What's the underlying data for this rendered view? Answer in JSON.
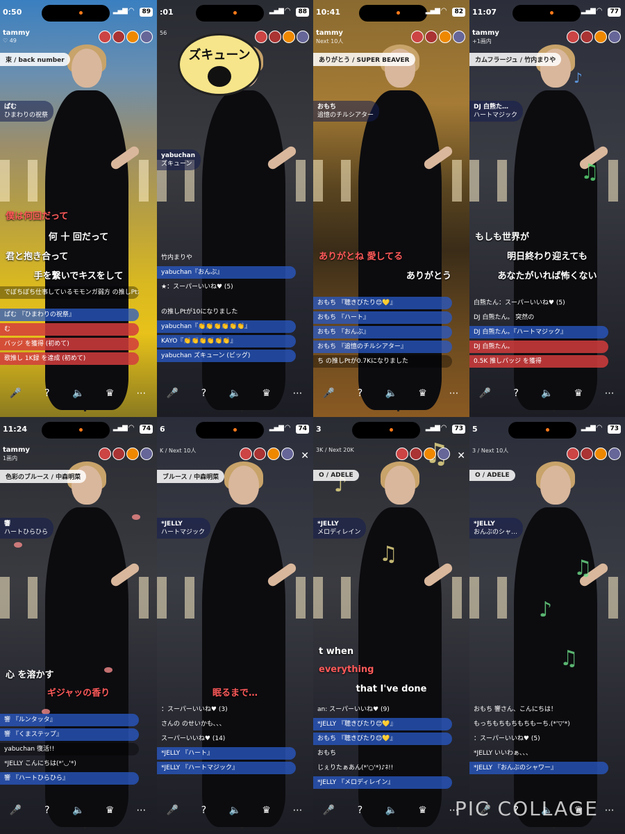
{
  "panels": [
    {
      "time": "0:50",
      "battery": "89",
      "host": "tammy",
      "host_sub": "♡ 49",
      "song": "束 / back number",
      "singer_name": "ぱむ",
      "singer_song": "ひまわりの祝祭",
      "lyrics": [
        "僕は何回だって",
        "何 十 回だって",
        "君と抱き合って",
        "手を繋いでキスをして"
      ],
      "feed": [
        "でぼちぼち仕事しているモモンガ弱方 の推しPtがになりました",
        "ぱむ 『ひまわりの祝祭』",
        "む",
        "バッジ を獲得 (初めて)",
        "歌推し 1K録 を達成 (初めて)"
      ]
    },
    {
      "time": ":01",
      "battery": "88",
      "host": "",
      "host_sub": "56",
      "sticker": "ズキューン",
      "singer_name": "yabuchan",
      "singer_song": "ズキューン",
      "feed": [
        "竹内まりや",
        "yabuchan『おんぶ』",
        "★：スーパーいいね♥ (5)",
        "の推しPtが10になりました",
        "yabuchan『👏👏👏👏👏👏』",
        "KAYO『👏👏👏👏👏👏』",
        "yabuchan ズキューン (ビッグ)"
      ]
    },
    {
      "time": "10:41",
      "battery": "82",
      "host": "tammy",
      "host_sub": "Next 10人",
      "song": "ありがとう / SUPER BEAVER",
      "singer_name": "おもち",
      "singer_song": "追憶のチルシアター",
      "lyrics": [
        "ありがとね 愛してる",
        "ありがとう"
      ],
      "feed": [
        "おもち 『聴きびたり😊💛』",
        "おもち 『ハート』",
        "おもち 『おんぶ』",
        "おもち 『追憶のチルシアター』",
        "ち の推しPtが0.7Kになりました"
      ]
    },
    {
      "time": "11:07",
      "battery": "77",
      "host": "tammy",
      "host_sub": "+1画内",
      "song": "カムフラージュ / 竹内まりや",
      "singer_name": "DJ 白熊た…",
      "singer_song": "ハートマジック",
      "lyrics": [
        "もしも世界が",
        "明日終わり迎えても",
        "あなたがいれば怖くない"
      ],
      "feed": [
        "白熊たん：スーパーいいね♥ (5)",
        "DJ 白熊たん。 突然の",
        "DJ 白熊たん。『ハートマジック』",
        "DJ 白熊たん。",
        "0.5K 推しバッジ を獲得"
      ]
    },
    {
      "time": "11:24",
      "battery": "74",
      "host": "tammy",
      "host_sub": "1画内",
      "song": "色彩のブルース / 中森明菜",
      "singer_name": "響",
      "singer_song": "ハートひらひら",
      "lyrics": [
        "心 を溶かす",
        "ギジャッの香り"
      ],
      "feed": [
        "響 『ルンタッタ』",
        "響 『くまステップ』",
        "yabuchan 復活!!",
        "*JELLY こんにちは(*'◡'*)",
        "響 『ハートひらひら』"
      ]
    },
    {
      "time": "6",
      "battery": "74",
      "host": "",
      "host_sub": "K / Next 10人",
      "song": "ブルース / 中森明菜",
      "singer_name": "*JELLY",
      "singer_song": "ハートマジック",
      "lyrics": [
        "眠るまで…"
      ],
      "feed": [
        "：スーパーいいね♥ (3)",
        "さんの のせいかも、、、",
        "スーパーいいね♥ (14)",
        "*JELLY 『ハート』",
        "*JELLY 『ハートマジック』"
      ]
    },
    {
      "time": "3",
      "battery": "73",
      "host": "",
      "host_sub": "3K / Next 20K",
      "song": "O / ADELE",
      "singer_name": "*JELLY",
      "singer_song": "メロディレイン",
      "lyrics": [
        "t when",
        "everything",
        "that I've done"
      ],
      "feed": [
        "an: スーパーいいね♥ (9)",
        "*JELLY 『聴きびたり😊💛』",
        "おもち 『聴きびたり😊💛』",
        "おもち",
        "じぇりたぁあん(*'○'*)♪ﾈ!!",
        "*JELLY 『メロディレイン』"
      ]
    },
    {
      "time": "5",
      "battery": "73",
      "host": "",
      "host_sub": "3 / Next 10人",
      "song": "O / ADELE",
      "singer_name": "*JELLY",
      "singer_song": "おんぶのシャ…",
      "feed": [
        "おもち 響さん、こんにちは！",
        "もっちもちもちもちもーち.(*'▽'*)",
        "：スーパーいいね♥ (5)",
        "*JELLY いいわぁ、、、",
        "*JELLY 『おんぶのシャワー』"
      ]
    }
  ],
  "toolbar_icons": [
    "mic-icon",
    "question-icon",
    "volume-icon",
    "crown-icon",
    "more-icon"
  ],
  "watermark": "PIC COLLAGE"
}
